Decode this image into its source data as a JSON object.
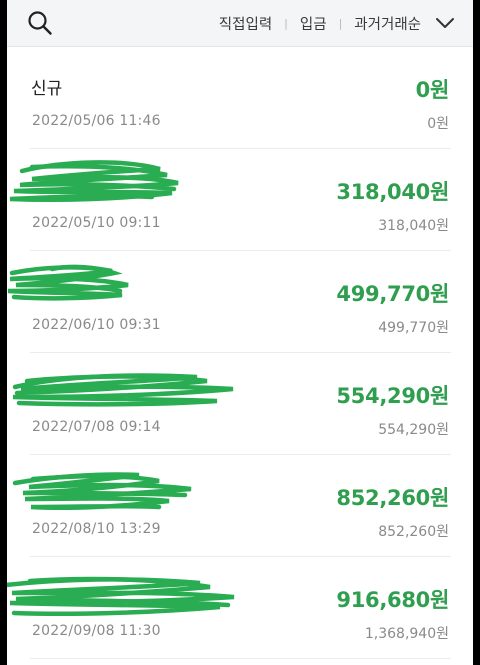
{
  "toolbar": {
    "search_icon": "search-icon",
    "filters": {
      "direct_input": "직접입력",
      "deposit": "입금",
      "past_transactions": "과거거래순"
    },
    "dropdown_icon": "chevron-down-icon"
  },
  "transactions": [
    {
      "name": "신규",
      "date": "2022/05/06  11:46",
      "amount": "0원",
      "balance": "0원"
    },
    {
      "name": "",
      "date": "2022/05/10  09:11",
      "amount": "318,040원",
      "balance": "318,040원"
    },
    {
      "name": "",
      "date": "2022/06/10  09:31",
      "amount": "499,770원",
      "balance": "499,770원"
    },
    {
      "name": "",
      "date": "2022/07/08  09:14",
      "amount": "554,290원",
      "balance": "554,290원"
    },
    {
      "name": "",
      "date": "2022/08/10  13:29",
      "amount": "852,260원",
      "balance": "852,260원"
    },
    {
      "name": "",
      "date": "2022/09/08  11:30",
      "amount": "916,680원",
      "balance": "1,368,940원"
    }
  ],
  "colors": {
    "amount_green": "#2f9e4f",
    "redaction_green": "#1fa84a"
  }
}
